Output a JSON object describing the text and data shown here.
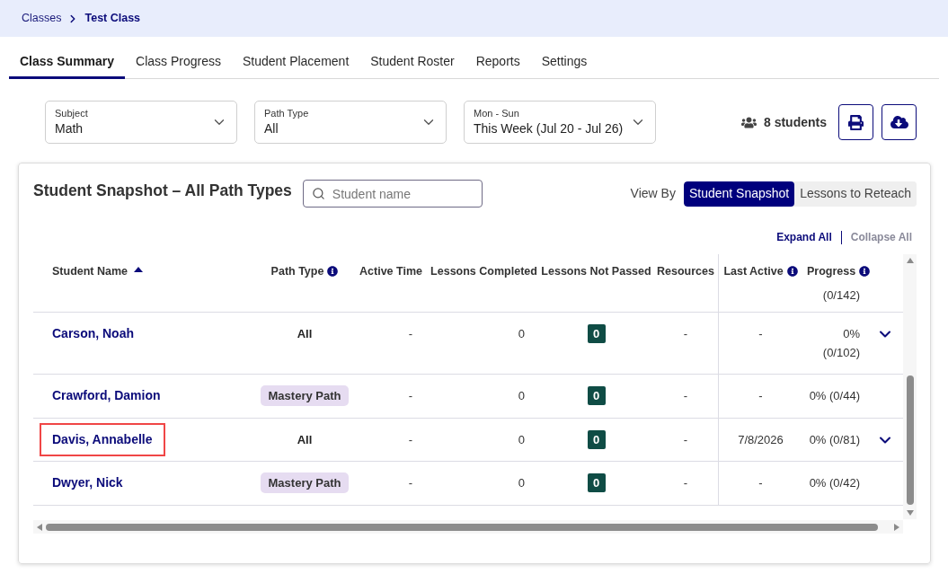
{
  "breadcrumb": [
    {
      "label": "Classes",
      "current": false
    },
    {
      "label": "Test Class",
      "current": true
    }
  ],
  "tabs": [
    {
      "label": "Class Summary",
      "selected": true
    },
    {
      "label": "Class Progress",
      "selected": false
    },
    {
      "label": "Student Placement",
      "selected": false
    },
    {
      "label": "Student Roster",
      "selected": false
    },
    {
      "label": "Reports",
      "selected": false
    },
    {
      "label": "Settings",
      "selected": false
    }
  ],
  "filters": [
    {
      "label": "Subject",
      "value": "Math"
    },
    {
      "label": "Path Type",
      "value": "All"
    },
    {
      "label": "Mon - Sun",
      "value": "This Week (Jul 20 - Jul 26)"
    }
  ],
  "student_count": "8 students",
  "snapshot": {
    "title": "Student Snapshot – All Path Types",
    "search": {
      "placeholder": "Student name"
    },
    "view_by": {
      "label": "View By",
      "options": [
        {
          "label": "Student Snapshot",
          "selected": true
        },
        {
          "label": "Lessons to Reteach",
          "selected": false
        }
      ]
    },
    "expand_all": {
      "label": "Expand All",
      "disabled": false
    },
    "collapse_all": {
      "label": "Collapse All",
      "disabled": true
    },
    "table": {
      "columns": [
        {
          "label": "Student Name",
          "sorted": true,
          "info": false
        },
        {
          "label": "Path Type",
          "sorted": false,
          "info": true
        },
        {
          "label": "Active Time",
          "sorted": false,
          "info": false
        },
        {
          "label": "Lessons Completed",
          "sorted": false,
          "info": false
        },
        {
          "label": "Lessons Not Passed",
          "sorted": false,
          "info": false
        },
        {
          "label": "Resources",
          "sorted": false,
          "info": false
        },
        {
          "label": "Last Active",
          "sorted": false,
          "info": true
        },
        {
          "label": "Progress",
          "sorted": false,
          "info": true
        }
      ],
      "partial_row": {
        "progress": "(0/142)"
      },
      "rows": [
        {
          "name": "Carson, Noah",
          "highlighted": false,
          "path_type": "All",
          "path_badge": false,
          "active_time": "-",
          "lessons_completed": "0",
          "lessons_not_passed": "0",
          "resources": "-",
          "last_active": "-",
          "progress": "0% (0/102)",
          "expandable": true
        },
        {
          "name": "Crawford, Damion",
          "highlighted": false,
          "path_type": "Mastery Path",
          "path_badge": true,
          "active_time": "-",
          "lessons_completed": "0",
          "lessons_not_passed": "0",
          "resources": "-",
          "last_active": "-",
          "progress": "0% (0/44)",
          "expandable": false
        },
        {
          "name": "Davis, Annabelle",
          "highlighted": true,
          "path_type": "All",
          "path_badge": false,
          "active_time": "-",
          "lessons_completed": "0",
          "lessons_not_passed": "0",
          "resources": "-",
          "last_active": "7/8/2026",
          "progress": "0% (0/81)",
          "expandable": true
        },
        {
          "name": "Dwyer, Nick",
          "highlighted": false,
          "path_type": "Mastery Path",
          "path_badge": true,
          "active_time": "-",
          "lessons_completed": "0",
          "lessons_not_passed": "0",
          "resources": "-",
          "last_active": "-",
          "progress": "0% (0/42)",
          "expandable": false
        }
      ]
    }
  }
}
